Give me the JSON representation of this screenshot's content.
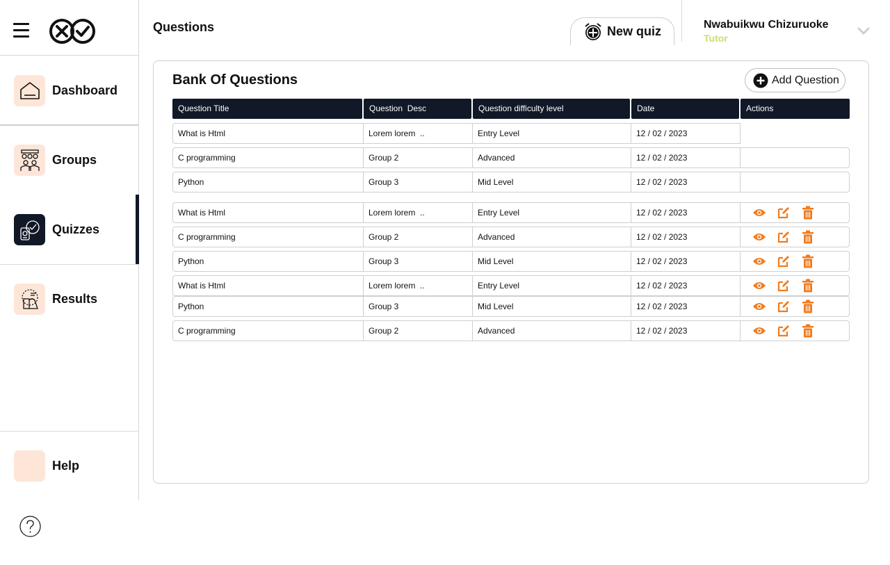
{
  "sidebar": {
    "items": [
      {
        "label": "Dashboard",
        "icon": "home-icon"
      },
      {
        "label": "Groups",
        "icon": "group-icon"
      },
      {
        "label": "Quizzes",
        "icon": "quiz-icon"
      },
      {
        "label": "Results",
        "icon": "results-icon"
      }
    ],
    "help_label": "Help",
    "active": "Quizzes"
  },
  "header": {
    "title": "Questions",
    "new_quiz_label": "New quiz",
    "user_name": "Nwabuikwu Chizuruoke",
    "user_role": "Tutor"
  },
  "panel": {
    "title": "Bank Of Questions",
    "add_label": "Add Question"
  },
  "table": {
    "headers": [
      "Question Title",
      "Question  Desc",
      "Question difficulty level",
      "Date",
      "Actions"
    ],
    "rows": [
      {
        "title": "What is Html",
        "desc": "Lorem lorem  ..",
        "level": "Entry Level",
        "date": "12 / 02 / 2023",
        "actions": false
      },
      {
        "title": "C programming",
        "desc": "Group 2",
        "level": "Advanced",
        "date": "12 / 02 / 2023",
        "actions": false
      },
      {
        "title": "Python",
        "desc": "Group 3",
        "level": "Mid Level",
        "date": "12 / 02 / 2023",
        "actions": false
      },
      {
        "title": "What is Html",
        "desc": "Lorem lorem  ..",
        "level": "Entry Level",
        "date": "12 / 02 / 2023",
        "actions": true
      },
      {
        "title": "C programming",
        "desc": "Group 2",
        "level": "Advanced",
        "date": "12 / 02 / 2023",
        "actions": true
      },
      {
        "title": "Python",
        "desc": "Group 3",
        "level": "Mid Level",
        "date": "12 / 02 / 2023",
        "actions": true
      },
      {
        "title": "What is Html",
        "desc": "Lorem lorem  ..",
        "level": "Entry Level",
        "date": "12 / 02 / 2023",
        "actions": true
      },
      {
        "title": "Python",
        "desc": "Group 3",
        "level": "Mid Level",
        "date": "12 / 02 / 2023",
        "actions": true
      },
      {
        "title": "C programming",
        "desc": "Group 2",
        "level": "Advanced",
        "date": "12 / 02 / 2023",
        "actions": true
      }
    ],
    "action_icons": [
      "view-icon",
      "edit-icon",
      "delete-icon"
    ]
  },
  "colors": {
    "dark": "#111827",
    "accent": "#f07c1f",
    "icon_bg": "#fde6d8",
    "role": "#c8e06e"
  }
}
